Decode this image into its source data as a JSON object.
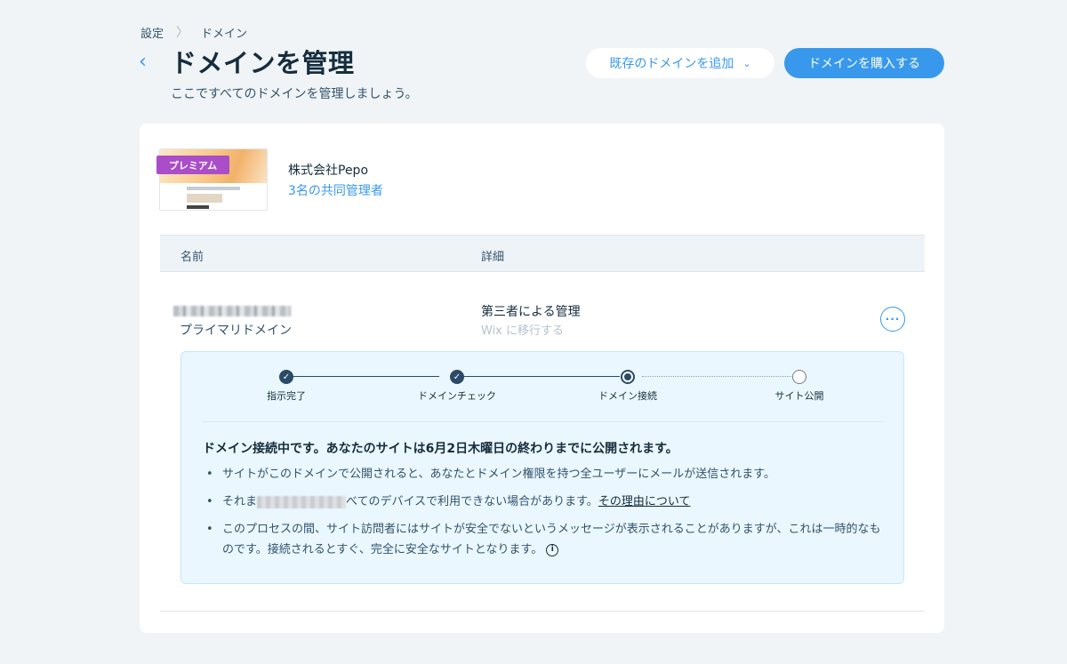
{
  "breadcrumb": {
    "settings": "設定",
    "separator": "〉",
    "current": "ドメイン"
  },
  "header": {
    "back_icon": "‹",
    "title": "ドメインを管理",
    "subtitle": "ここですべてのドメインを管理しましょう。",
    "add_existing_label": "既存のドメインを追加",
    "add_existing_chevron": "⌄",
    "buy_label": "ドメインを購入する"
  },
  "site": {
    "badge": "プレミアム",
    "name": "株式会社Pepo",
    "co_admins": "3名の共同管理者"
  },
  "table": {
    "columns": [
      "名前",
      "詳細"
    ],
    "row": {
      "domain_type": "プライマリドメイン",
      "managed_by": "第三者による管理",
      "move_to_wix": "Wix に移行する",
      "more": "···"
    }
  },
  "progress": {
    "steps": [
      {
        "label": "指示完了",
        "state": "done"
      },
      {
        "label": "ドメインチェック",
        "state": "done"
      },
      {
        "label": "ドメイン接続",
        "state": "current"
      },
      {
        "label": "サイト公開",
        "state": "todo"
      }
    ],
    "check_icon": "✓"
  },
  "status": {
    "title": "ドメイン接続中です。あなたのサイトは6月2日木曜日の終わりまでに公開されます。",
    "bullet1": "サイトがこのドメインで公開されると、あなたとドメイン権限を持つ全ユーザーにメールが送信されます。",
    "bullet2_pre": "それま",
    "bullet2_post": "べてのデバイスで利用できない場合があります。",
    "bullet2_link": "その理由について",
    "bullet3": "このプロセスの間、サイト訪問者にはサイトが安全でないというメッセージが表示されることがありますが、これは一時的なものです。接続されるとすぐ、完全に安全なサイトとなります。",
    "info_icon": "i"
  },
  "colors": {
    "accent": "#3899ec",
    "premium": "#aa4dc8",
    "status_bg": "#eaf7ff",
    "dark": "#162d3d"
  }
}
